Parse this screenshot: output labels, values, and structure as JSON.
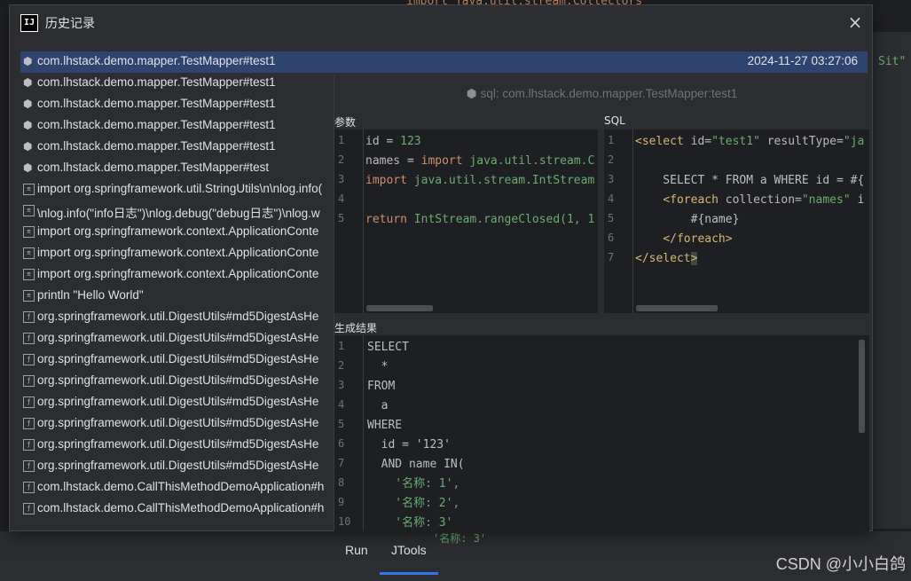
{
  "background": {
    "top_code": "import java.util.stream.Collectors",
    "right_fragment": "Sit\"",
    "bottom_tabs": [
      "Run",
      "JTools"
    ],
    "bottom_code": "'名称: 3'",
    "watermark": "CSDN @小小白鸽"
  },
  "dialog": {
    "title": "历史记录",
    "app_icon": "IJ",
    "close_icon": "×"
  },
  "history": {
    "selected_time": "2024-11-27 03:27:06",
    "items": [
      {
        "label": "com.lhstack.demo.mapper.TestMapper#test1",
        "icon": "cube-icon"
      },
      {
        "label": "com.lhstack.demo.mapper.TestMapper#test1",
        "icon": "cube-icon"
      },
      {
        "label": "com.lhstack.demo.mapper.TestMapper#test1",
        "icon": "cube-icon"
      },
      {
        "label": "com.lhstack.demo.mapper.TestMapper#test1",
        "icon": "cube-icon"
      },
      {
        "label": "com.lhstack.demo.mapper.TestMapper#test1",
        "icon": "cube-icon"
      },
      {
        "label": "com.lhstack.demo.mapper.TestMapper#test",
        "icon": "cube-icon"
      },
      {
        "label": "import org.springframework.util.StringUtils\\n\\nlog.info(",
        "icon": "script-icon"
      },
      {
        "label": "\\nlog.info(\"info日志\")\\nlog.debug(\"debug日志\")\\nlog.w",
        "icon": "script-icon"
      },
      {
        "label": "import org.springframework.context.ApplicationConte",
        "icon": "script-icon"
      },
      {
        "label": "import org.springframework.context.ApplicationConte",
        "icon": "script-icon"
      },
      {
        "label": "import org.springframework.context.ApplicationConte",
        "icon": "script-icon"
      },
      {
        "label": "println \"Hello World\"",
        "icon": "script-icon"
      },
      {
        "label": "org.springframework.util.DigestUtils#md5DigestAsHe",
        "icon": "method-icon"
      },
      {
        "label": "org.springframework.util.DigestUtils#md5DigestAsHe",
        "icon": "method-icon"
      },
      {
        "label": "org.springframework.util.DigestUtils#md5DigestAsHe",
        "icon": "method-icon"
      },
      {
        "label": "org.springframework.util.DigestUtils#md5DigestAsHe",
        "icon": "method-icon"
      },
      {
        "label": "org.springframework.util.DigestUtils#md5DigestAsHe",
        "icon": "method-icon"
      },
      {
        "label": "org.springframework.util.DigestUtils#md5DigestAsHe",
        "icon": "method-icon"
      },
      {
        "label": "org.springframework.util.DigestUtils#md5DigestAsHe",
        "icon": "method-icon"
      },
      {
        "label": "org.springframework.util.DigestUtils#md5DigestAsHe",
        "icon": "method-icon"
      },
      {
        "label": "com.lhstack.demo.CallThisMethodDemoApplication#h",
        "icon": "method-icon"
      },
      {
        "label": "com.lhstack.demo.CallThisMethodDemoApplication#h",
        "icon": "method-icon"
      }
    ]
  },
  "preview": {
    "title": "sql: com.lhstack.demo.mapper.TestMapper:test1",
    "params_label": "参数",
    "sql_label": "SQL",
    "result_label": "生成结果",
    "params_lines": [
      "1",
      "2",
      "3",
      "4",
      "5"
    ],
    "sql_lines": [
      "1",
      "2",
      "3",
      "4",
      "5",
      "6",
      "7"
    ],
    "result_lines": [
      "1",
      "2",
      "3",
      "4",
      "5",
      "6",
      "7",
      "8",
      "9",
      "10"
    ],
    "result_code": [
      "SELECT",
      "  *",
      "FROM",
      "  a",
      "WHERE",
      "  id = '123'",
      "  AND name IN(",
      "    '名称: 1',",
      "    '名称: 2',",
      "    '名称: 3'"
    ]
  }
}
